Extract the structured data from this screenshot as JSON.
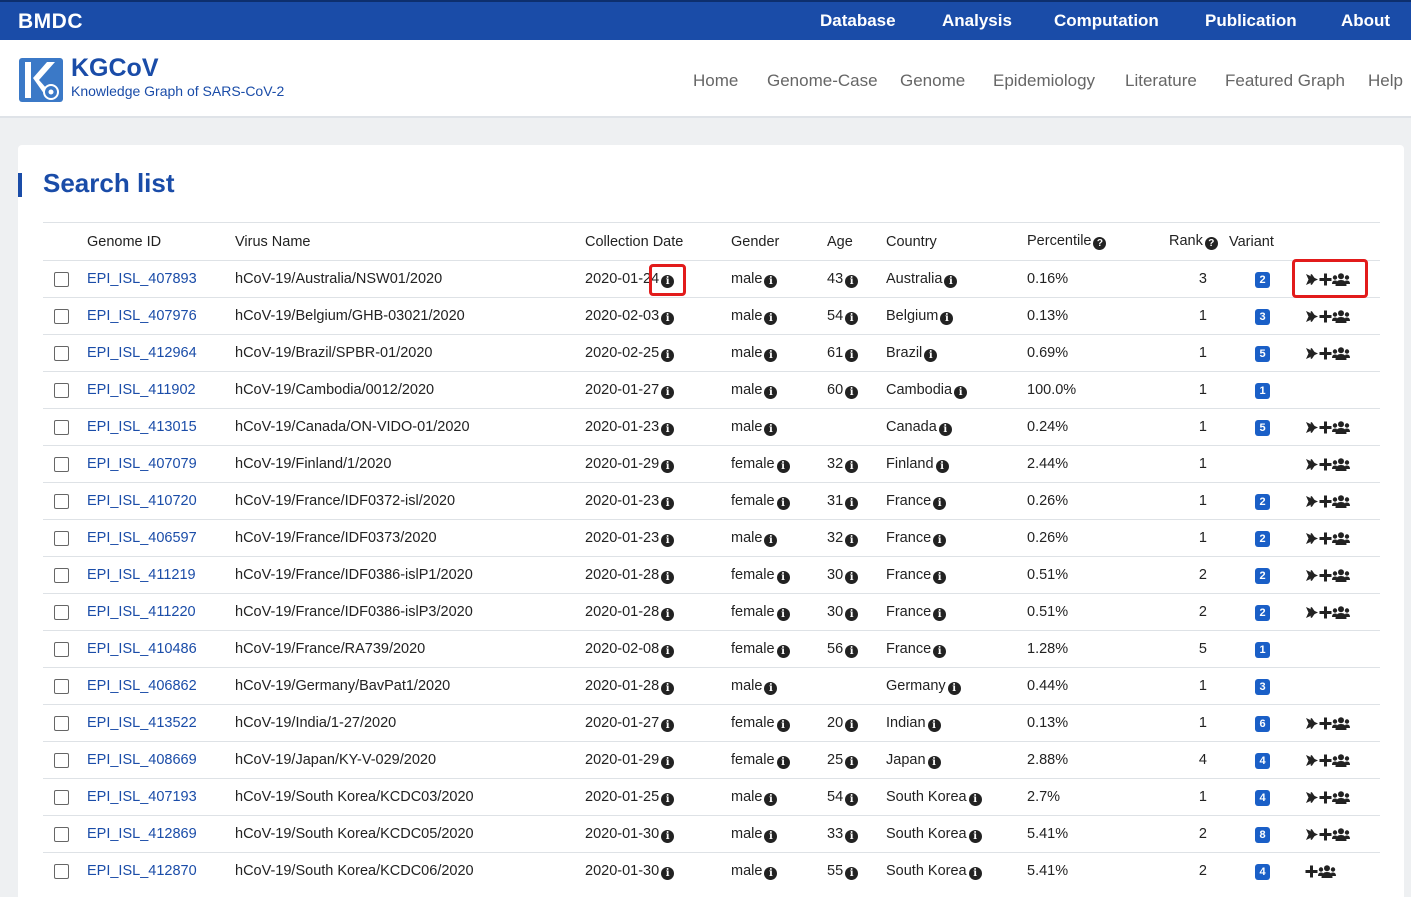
{
  "topbar": {
    "brand": "BMDC",
    "nav": [
      "Database",
      "Analysis",
      "Computation",
      "Publication",
      "About"
    ]
  },
  "site": {
    "title": "KGCoV",
    "subtitle": "Knowledge Graph of SARS-CoV-2",
    "nav": [
      "Home",
      "Genome-Case",
      "Genome",
      "Epidemiology",
      "Literature",
      "Featured Graph",
      "Help"
    ]
  },
  "page": {
    "title": "Search list"
  },
  "table": {
    "headers": [
      "Genome ID",
      "Virus Name",
      "Collection Date",
      "Gender",
      "Age",
      "Country",
      "Percentile",
      "Rank",
      "Variant"
    ],
    "rows": [
      {
        "id": "EPI_ISL_407893",
        "virus": "hCoV-19/Australia/NSW01/2020",
        "date": "2020-01-24",
        "gender": "male",
        "age": "43",
        "country": "Australia",
        "pct": "0.16%",
        "rank": "3",
        "variant": "2",
        "icons": "plane-plus-group"
      },
      {
        "id": "EPI_ISL_407976",
        "virus": "hCoV-19/Belgium/GHB-03021/2020",
        "date": "2020-02-03",
        "gender": "male",
        "age": "54",
        "country": "Belgium",
        "pct": "0.13%",
        "rank": "1",
        "variant": "3",
        "icons": "plane-plus-group"
      },
      {
        "id": "EPI_ISL_412964",
        "virus": "hCoV-19/Brazil/SPBR-01/2020",
        "date": "2020-02-25",
        "gender": "male",
        "age": "61",
        "country": "Brazil",
        "pct": "0.69%",
        "rank": "1",
        "variant": "5",
        "icons": "plane-plus-group"
      },
      {
        "id": "EPI_ISL_411902",
        "virus": "hCoV-19/Cambodia/0012/2020",
        "date": "2020-01-27",
        "gender": "male",
        "age": "60",
        "country": "Cambodia",
        "pct": "100.0%",
        "rank": "1",
        "variant": "1",
        "icons": ""
      },
      {
        "id": "EPI_ISL_413015",
        "virus": "hCoV-19/Canada/ON-VIDO-01/2020",
        "date": "2020-01-23",
        "gender": "male",
        "age": "",
        "country": "Canada",
        "pct": "0.24%",
        "rank": "1",
        "variant": "5",
        "icons": "plane-plus-group"
      },
      {
        "id": "EPI_ISL_407079",
        "virus": "hCoV-19/Finland/1/2020",
        "date": "2020-01-29",
        "gender": "female",
        "age": "32",
        "country": "Finland",
        "pct": "2.44%",
        "rank": "1",
        "variant": "",
        "icons": "plane-plus-group"
      },
      {
        "id": "EPI_ISL_410720",
        "virus": "hCoV-19/France/IDF0372-isl/2020",
        "date": "2020-01-23",
        "gender": "female",
        "age": "31",
        "country": "France",
        "pct": "0.26%",
        "rank": "1",
        "variant": "2",
        "icons": "plane-plus-group"
      },
      {
        "id": "EPI_ISL_406597",
        "virus": "hCoV-19/France/IDF0373/2020",
        "date": "2020-01-23",
        "gender": "male",
        "age": "32",
        "country": "France",
        "pct": "0.26%",
        "rank": "1",
        "variant": "2",
        "icons": "plane-plus-group"
      },
      {
        "id": "EPI_ISL_411219",
        "virus": "hCoV-19/France/IDF0386-islP1/2020",
        "date": "2020-01-28",
        "gender": "female",
        "age": "30",
        "country": "France",
        "pct": "0.51%",
        "rank": "2",
        "variant": "2",
        "icons": "plane-plus-group"
      },
      {
        "id": "EPI_ISL_411220",
        "virus": "hCoV-19/France/IDF0386-islP3/2020",
        "date": "2020-01-28",
        "gender": "female",
        "age": "30",
        "country": "France",
        "pct": "0.51%",
        "rank": "2",
        "variant": "2",
        "icons": "plane-plus-group"
      },
      {
        "id": "EPI_ISL_410486",
        "virus": "hCoV-19/France/RA739/2020",
        "date": "2020-02-08",
        "gender": "female",
        "age": "56",
        "country": "France",
        "pct": "1.28%",
        "rank": "5",
        "variant": "1",
        "icons": ""
      },
      {
        "id": "EPI_ISL_406862",
        "virus": "hCoV-19/Germany/BavPat1/2020",
        "date": "2020-01-28",
        "gender": "male",
        "age": "",
        "country": "Germany",
        "pct": "0.44%",
        "rank": "1",
        "variant": "3",
        "icons": ""
      },
      {
        "id": "EPI_ISL_413522",
        "virus": "hCoV-19/India/1-27/2020",
        "date": "2020-01-27",
        "gender": "female",
        "age": "20",
        "country": "Indian",
        "pct": "0.13%",
        "rank": "1",
        "variant": "6",
        "icons": "plane-plus-group"
      },
      {
        "id": "EPI_ISL_408669",
        "virus": "hCoV-19/Japan/KY-V-029/2020",
        "date": "2020-01-29",
        "gender": "female",
        "age": "25",
        "country": "Japan",
        "pct": "2.88%",
        "rank": "4",
        "variant": "4",
        "icons": "plane-plus-group"
      },
      {
        "id": "EPI_ISL_407193",
        "virus": "hCoV-19/South Korea/KCDC03/2020",
        "date": "2020-01-25",
        "gender": "male",
        "age": "54",
        "country": "South Korea",
        "pct": "2.7%",
        "rank": "1",
        "variant": "4",
        "icons": "plane-plus-group"
      },
      {
        "id": "EPI_ISL_412869",
        "virus": "hCoV-19/South Korea/KCDC05/2020",
        "date": "2020-01-30",
        "gender": "male",
        "age": "33",
        "country": "South Korea",
        "pct": "5.41%",
        "rank": "2",
        "variant": "8",
        "icons": "plane-plus-group"
      },
      {
        "id": "EPI_ISL_412870",
        "virus": "hCoV-19/South Korea/KCDC06/2020",
        "date": "2020-01-30",
        "gender": "male",
        "age": "55",
        "country": "South Korea",
        "pct": "5.41%",
        "rank": "2",
        "variant": "4",
        "icons": "plus-group"
      }
    ]
  },
  "colors": {
    "primary": "#1a4ca8",
    "badge": "#1a5fc7",
    "highlight": "#e21b1b"
  }
}
